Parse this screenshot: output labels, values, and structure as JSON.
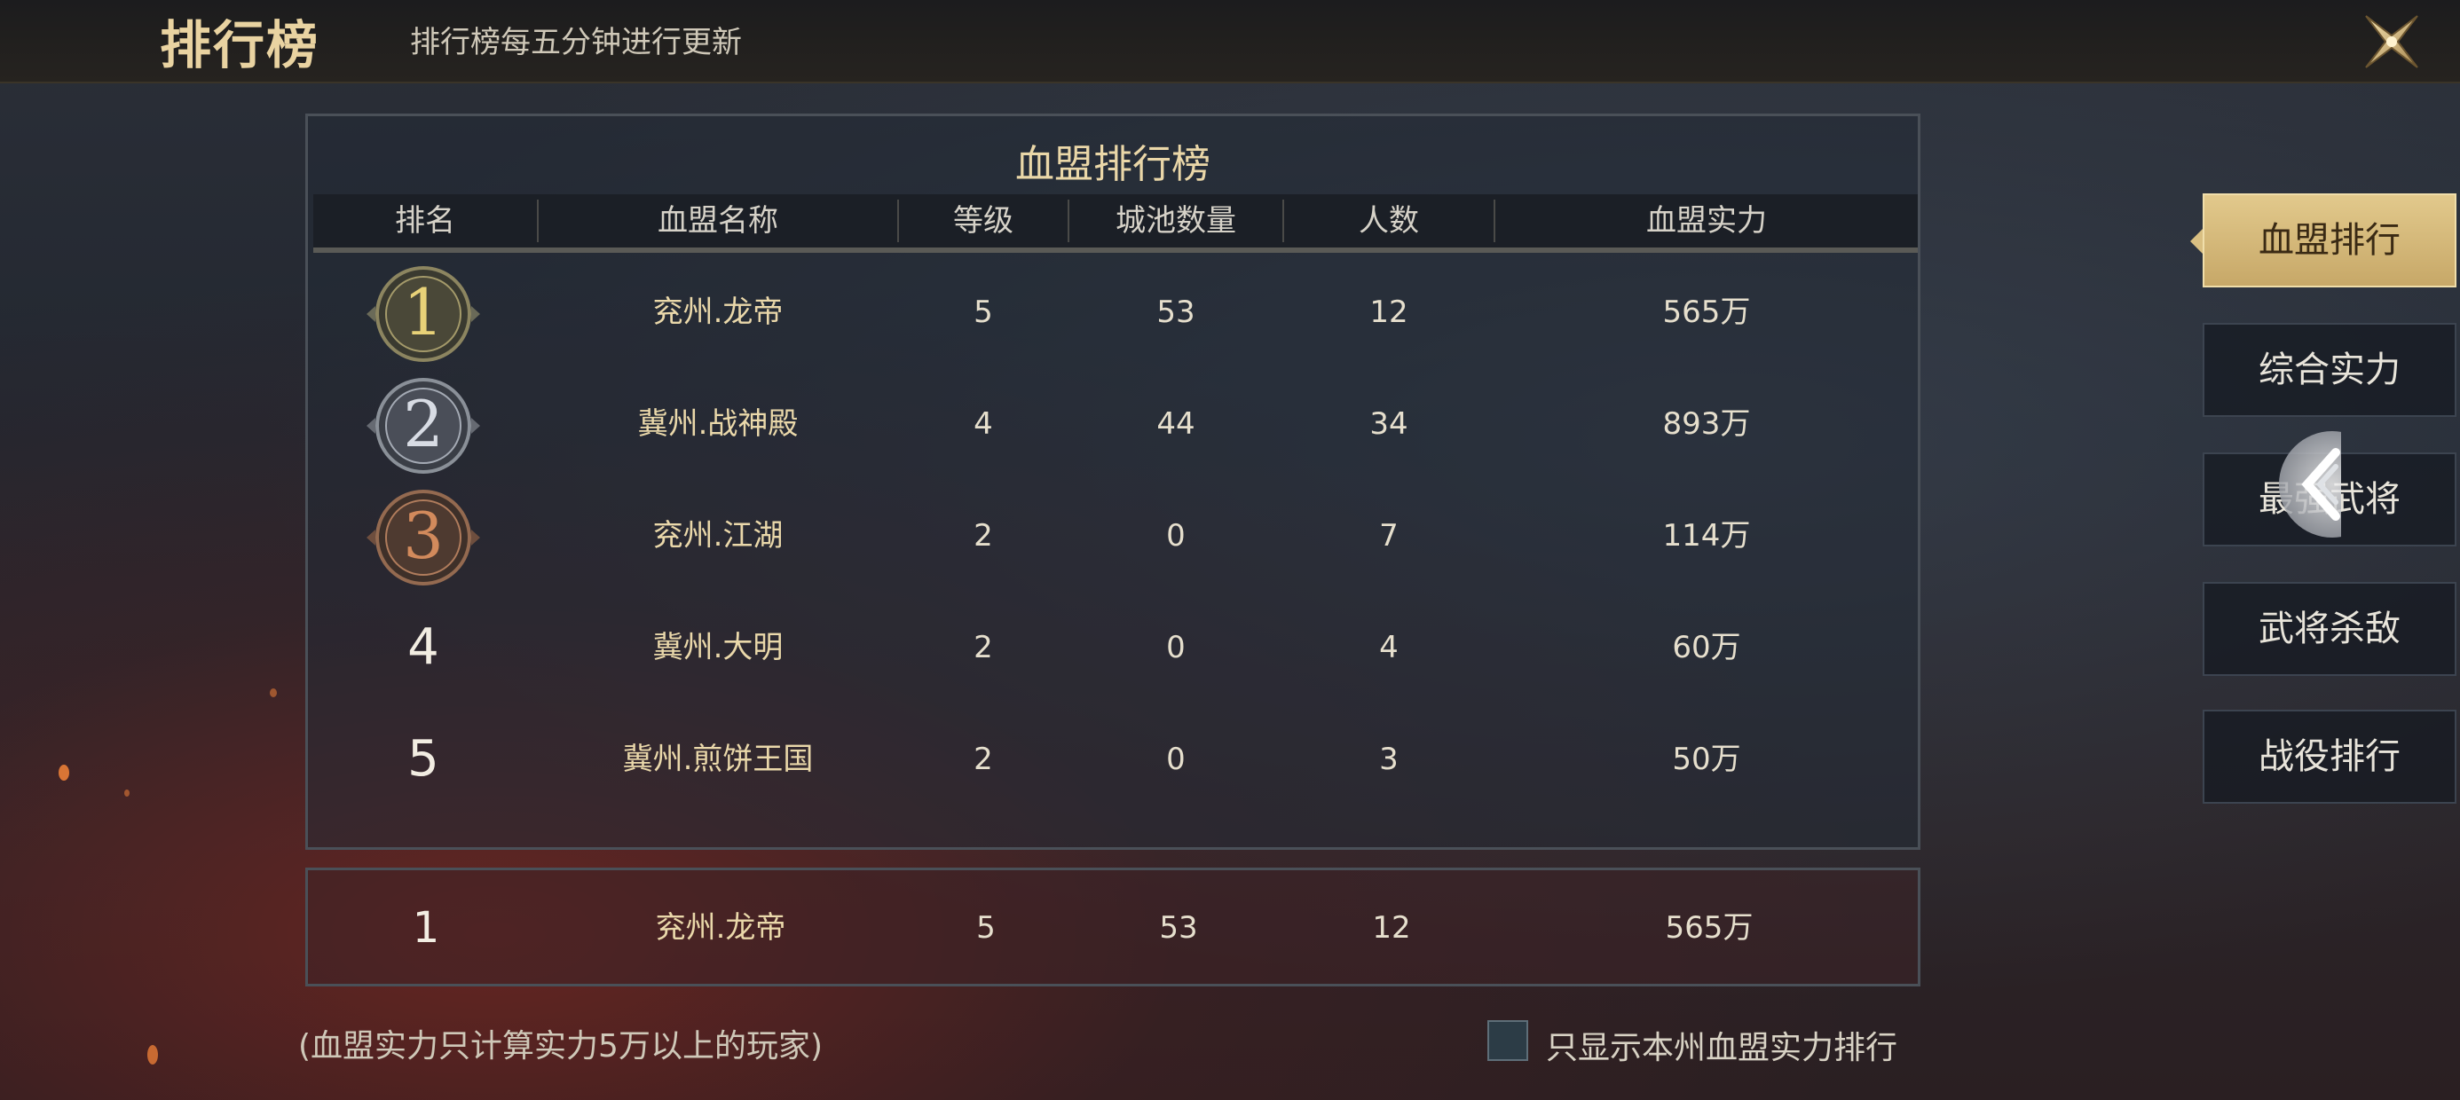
{
  "header": {
    "title": "排行榜",
    "subtitle": "排行榜每五分钟进行更新"
  },
  "table": {
    "title": "血盟排行榜",
    "columns": [
      "排名",
      "血盟名称",
      "等级",
      "城池数量",
      "人数",
      "血盟实力"
    ],
    "rows": [
      {
        "rank": "1",
        "name": "兖州.龙帝",
        "level": "5",
        "cities": "53",
        "members": "12",
        "power": "565万"
      },
      {
        "rank": "2",
        "name": "冀州.战神殿",
        "level": "4",
        "cities": "44",
        "members": "34",
        "power": "893万"
      },
      {
        "rank": "3",
        "name": "兖州.江湖",
        "level": "2",
        "cities": "0",
        "members": "7",
        "power": "114万"
      },
      {
        "rank": "4",
        "name": "冀州.大明",
        "level": "2",
        "cities": "0",
        "members": "4",
        "power": "60万"
      },
      {
        "rank": "5",
        "name": "冀州.煎饼王国",
        "level": "2",
        "cities": "0",
        "members": "3",
        "power": "50万"
      }
    ],
    "my_row": {
      "rank": "1",
      "name": "兖州.龙帝",
      "level": "5",
      "cities": "53",
      "members": "12",
      "power": "565万"
    }
  },
  "footer": {
    "note": "(血盟实力只计算实力5万以上的玩家)",
    "checkbox_label": "只显示本州血盟实力排行"
  },
  "tabs": [
    "血盟排行",
    "综合实力",
    "最强武将",
    "武将杀敌",
    "战役排行"
  ],
  "colors": {
    "gold": "#e9d3a1",
    "active_tab": "#d9bf82",
    "medal_gold": "#e8d278",
    "medal_silver": "#d8dce4",
    "medal_bronze": "#d28a5c"
  }
}
